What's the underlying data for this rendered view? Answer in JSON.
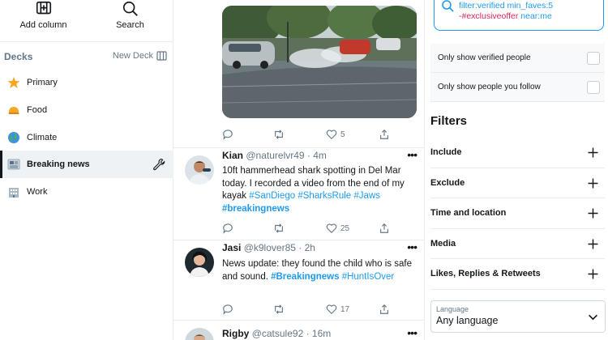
{
  "sidebar": {
    "add_column_label": "Add column",
    "search_label": "Search",
    "decks_title": "Decks",
    "new_deck_label": "New Deck",
    "decks": [
      {
        "label": "Primary",
        "icon": "star-icon"
      },
      {
        "label": "Food",
        "icon": "food-icon"
      },
      {
        "label": "Climate",
        "icon": "globe-icon"
      },
      {
        "label": "Breaking news",
        "icon": "newspaper-icon",
        "active": true
      },
      {
        "label": "Work",
        "icon": "building-icon"
      }
    ]
  },
  "feed": {
    "photo_actions": {
      "likes": "5"
    },
    "tweets": [
      {
        "name": "Kian",
        "handle": "@naturelvr49",
        "time": "· 4m",
        "text_parts": [
          "10ft hammerhead shark spotting in Del Mar today. I recorded a video from the end of my kayak ",
          "#SanDiego",
          " ",
          "#SharksRule",
          " ",
          "#Jaws",
          " ",
          "#breakingnews"
        ],
        "likes": "25"
      },
      {
        "name": "Jasi",
        "handle": "@k9lover85",
        "time": "· 2h",
        "text_parts": [
          "News update: they found the child who is safe and sound. ",
          "#Breakingnews",
          " ",
          "#HuntIsOver"
        ],
        "likes": "17"
      },
      {
        "name": "Rigby",
        "handle": "@catsule92",
        "time": "· 16m"
      }
    ]
  },
  "right_panel": {
    "query_line1": "filter:verified min_faves:5",
    "query_line2_red": "-#exclusiveoffer",
    "query_line2_blue": " near:me",
    "only_verified_label": "Only show verified people",
    "only_follow_label": "Only show people you follow",
    "filters_title": "Filters",
    "filters": [
      "Include",
      "Exclude",
      "Time and location",
      "Media",
      "Likes, Replies & Retweets"
    ],
    "language_label": "Language",
    "language_value": "Any language"
  },
  "colors": {
    "accent": "#1d9bf0",
    "negative": "#e0245e",
    "text": "#14171a",
    "muted": "#657786"
  }
}
